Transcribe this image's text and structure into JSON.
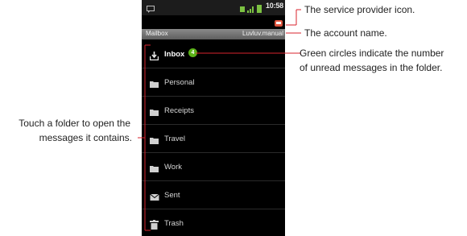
{
  "status_bar": {
    "time": "10:58"
  },
  "title_bar": {
    "title": "Mailbox",
    "account": "Luvluv.manual"
  },
  "folders": [
    {
      "label": "Inbox",
      "unread": "4"
    },
    {
      "label": "Personal"
    },
    {
      "label": "Receipts"
    },
    {
      "label": "Travel"
    },
    {
      "label": "Work"
    },
    {
      "label": "Sent"
    },
    {
      "label": "Trash"
    }
  ],
  "annotations": {
    "provider": "The service provider icon.",
    "account": "The account name.",
    "unread_line1": "Green circles indicate the number",
    "unread_line2": "of unread messages in the folder.",
    "touch_line1": "Touch a folder to open the",
    "touch_line2": "messages it contains."
  },
  "colors": {
    "badge": "#5bb318",
    "screen": "#000000",
    "title_bar": "#6e6e6e"
  }
}
